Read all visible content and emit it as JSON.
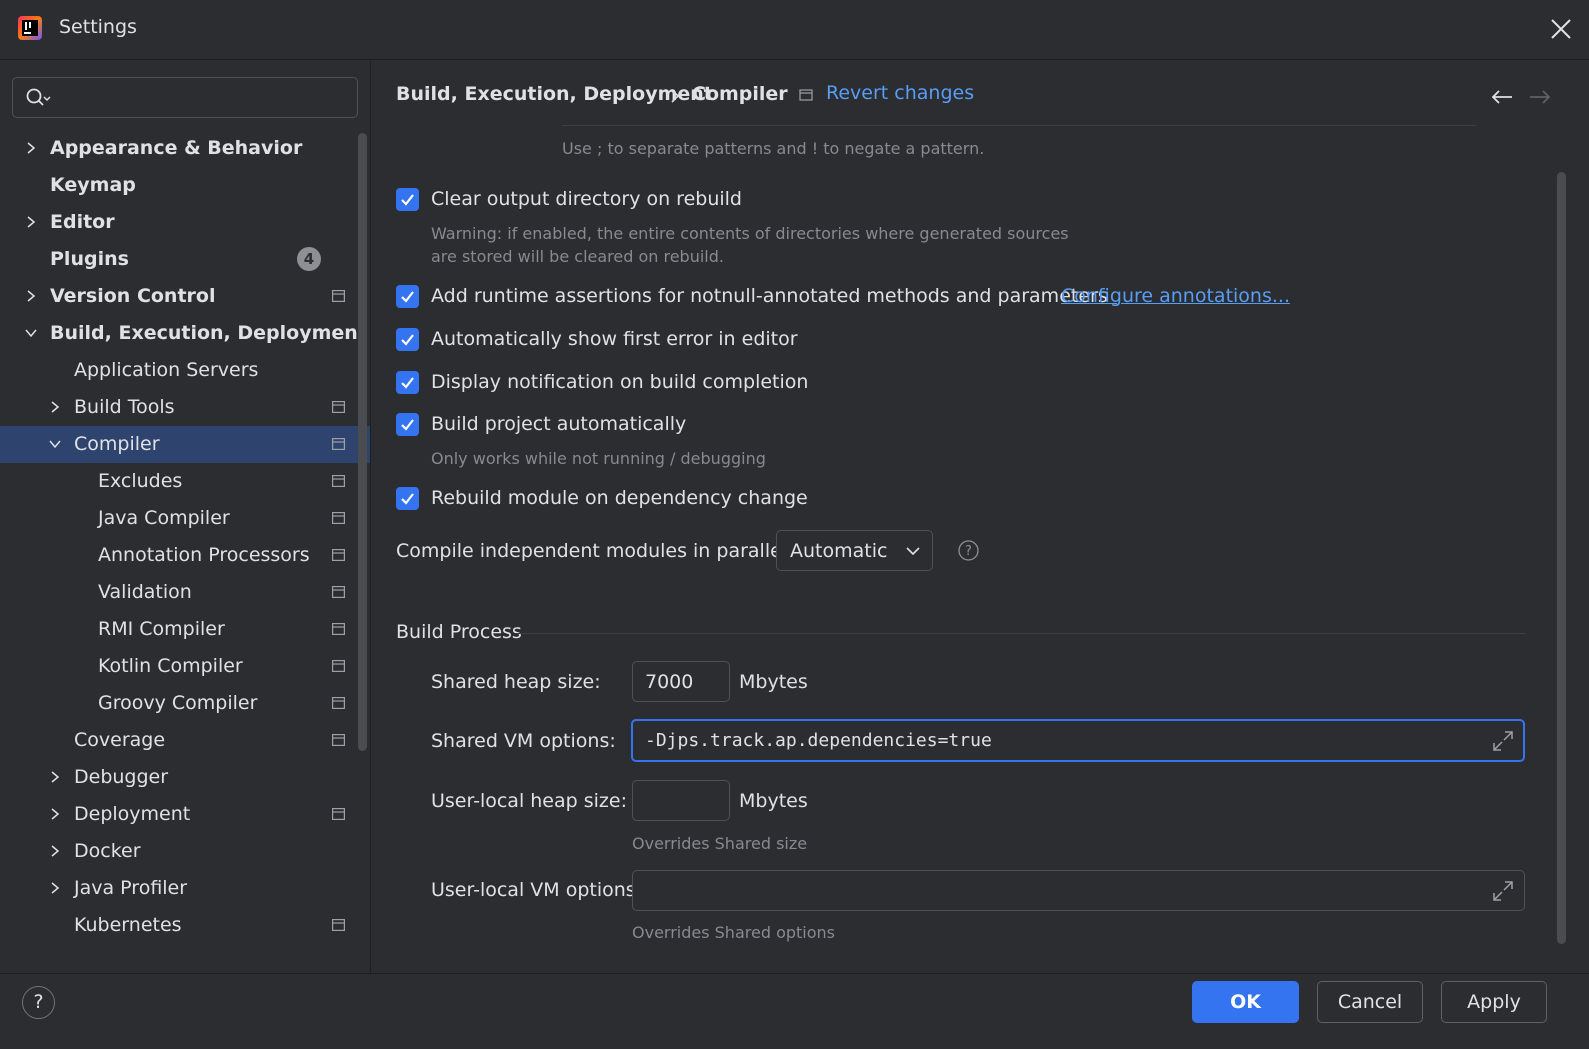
{
  "window": {
    "title": "Settings",
    "accent_color": "#3574f0",
    "link_color": "#589df6"
  },
  "sidebar": {
    "search": {
      "value": "",
      "placeholder": ""
    },
    "items": [
      {
        "label": "Appearance & Behavior",
        "level": 0,
        "bold": true,
        "expandable": true,
        "expanded": false
      },
      {
        "label": "Keymap",
        "level": 0,
        "bold": true,
        "expandable": false
      },
      {
        "label": "Editor",
        "level": 0,
        "bold": true,
        "expandable": true,
        "expanded": false
      },
      {
        "label": "Plugins",
        "level": 0,
        "bold": true,
        "expandable": false,
        "badge": "4"
      },
      {
        "label": "Version Control",
        "level": 0,
        "bold": true,
        "expandable": true,
        "expanded": false,
        "project_icon": true
      },
      {
        "label": "Build, Execution, Deployment",
        "level": 0,
        "bold": true,
        "expandable": true,
        "expanded": true
      },
      {
        "label": "Application Servers",
        "level": 1,
        "expandable": false
      },
      {
        "label": "Build Tools",
        "level": 1,
        "expandable": true,
        "expanded": false,
        "project_icon": true
      },
      {
        "label": "Compiler",
        "level": 1,
        "expandable": true,
        "expanded": true,
        "selected": true,
        "project_icon": true
      },
      {
        "label": "Excludes",
        "level": 2,
        "project_icon": true
      },
      {
        "label": "Java Compiler",
        "level": 2,
        "project_icon": true
      },
      {
        "label": "Annotation Processors",
        "level": 2,
        "project_icon": true
      },
      {
        "label": "Validation",
        "level": 2,
        "project_icon": true
      },
      {
        "label": "RMI Compiler",
        "level": 2,
        "project_icon": true
      },
      {
        "label": "Kotlin Compiler",
        "level": 2,
        "project_icon": true
      },
      {
        "label": "Groovy Compiler",
        "level": 2,
        "project_icon": true
      },
      {
        "label": "Coverage",
        "level": 1,
        "project_icon": true
      },
      {
        "label": "Debugger",
        "level": 1,
        "expandable": true,
        "expanded": false
      },
      {
        "label": "Deployment",
        "level": 1,
        "expandable": true,
        "expanded": false,
        "project_icon": true
      },
      {
        "label": "Docker",
        "level": 1,
        "expandable": true,
        "expanded": false
      },
      {
        "label": "Java Profiler",
        "level": 1,
        "expandable": true,
        "expanded": false
      },
      {
        "label": "Kubernetes",
        "level": 1,
        "project_icon": true
      }
    ]
  },
  "header": {
    "breadcrumb_parent": "Build, Execution, Deployment",
    "breadcrumb_current": "Compiler",
    "revert_label": "Revert changes",
    "back_icon": "arrow-left-icon",
    "forward_icon": "arrow-right-icon"
  },
  "main": {
    "pattern_hint": "Use ; to separate patterns and ! to negate a pattern.",
    "checkboxes": [
      {
        "label": "Clear output directory on rebuild",
        "checked": true,
        "hint": "Warning: if enabled, the entire contents of directories where generated sources",
        "hint2": "are stored will be cleared on rebuild."
      },
      {
        "label": "Add runtime assertions for notnull-annotated methods and parameters",
        "checked": true,
        "link": "Configure annotations..."
      },
      {
        "label": "Automatically show first error in editor",
        "checked": true
      },
      {
        "label": "Display notification on build completion",
        "checked": true
      },
      {
        "label": "Build project automatically",
        "checked": true,
        "hint": "Only works while not running / debugging"
      },
      {
        "label": "Rebuild module on dependency change",
        "checked": true
      }
    ],
    "parallel": {
      "label": "Compile independent modules in parallel:",
      "value": "Automatic"
    },
    "build_process": {
      "title": "Build Process",
      "shared_heap_label": "Shared heap size:",
      "shared_heap_value": "7000",
      "mbytes": "Mbytes",
      "shared_vm_label": "Shared VM options:",
      "shared_vm_value": "-Djps.track.ap.dependencies=true",
      "local_heap_label": "User-local heap size:",
      "local_heap_value": "",
      "local_heap_hint": "Overrides Shared size",
      "local_vm_label": "User-local VM options:",
      "local_vm_value": "",
      "local_vm_hint": "Overrides Shared options"
    }
  },
  "footer": {
    "help": "?",
    "ok": "OK",
    "cancel": "Cancel",
    "apply": "Apply"
  }
}
